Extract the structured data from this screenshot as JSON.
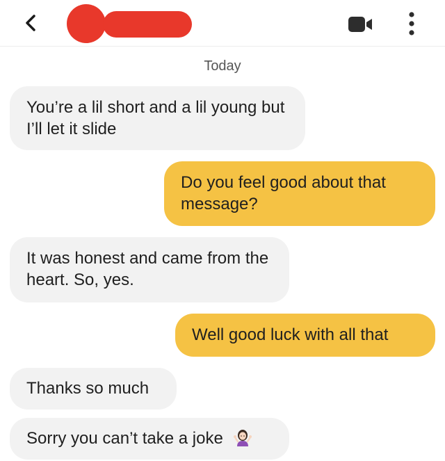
{
  "header": {
    "back_icon": "chevron-left-icon",
    "video_icon": "video-camera-icon",
    "more_icon": "vertical-dots-icon",
    "redaction_color": "#e8382b"
  },
  "conversation": {
    "date_label": "Today",
    "messages": [
      {
        "direction": "incoming",
        "text": "You’re a lil short and a lil young but I’ll let it slide"
      },
      {
        "direction": "outgoing",
        "text": "Do you feel good about that message?"
      },
      {
        "direction": "incoming",
        "text": "It was honest and came from the heart. So, yes."
      },
      {
        "direction": "outgoing",
        "text": "Well good luck with all that"
      },
      {
        "direction": "incoming",
        "text": "Thanks so much"
      },
      {
        "direction": "incoming",
        "text": "Sorry you can’t take a joke",
        "emoji": "person-shrugging-emoji"
      }
    ]
  },
  "colors": {
    "incoming_bubble": "#f2f2f2",
    "outgoing_bubble": "#f5c244",
    "text": "#1f1f1f"
  }
}
